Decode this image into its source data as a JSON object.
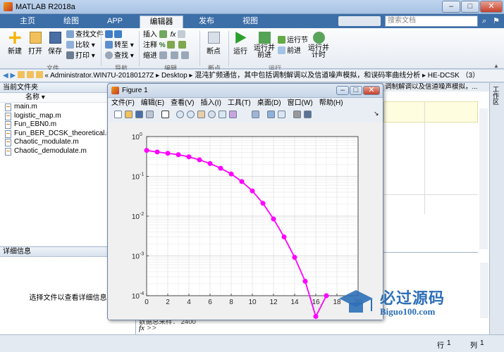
{
  "window": {
    "title": "MATLAB R2018a"
  },
  "tabs": [
    "主页",
    "绘图",
    "APP",
    "编辑器",
    "发布",
    "视图"
  ],
  "search_placeholder": "搜索文档",
  "ribbon": {
    "file": {
      "new": "新建",
      "open": "打开",
      "save": "保存",
      "find_files": "查找文件",
      "compare": "比较",
      "print": "打印",
      "group": "文件"
    },
    "nav": {
      "goto": "转至",
      "find": "查找",
      "group": "导航"
    },
    "edit": {
      "insert": "插入",
      "comment": "注释",
      "indent": "缩进",
      "fx": "fx",
      "group": "编辑"
    },
    "breakpoints": {
      "breakpoints": "断点",
      "group": "断点"
    },
    "run": {
      "run": "运行",
      "run_advance": "运行并\n前进",
      "run_section": "运行节",
      "advance": "前进",
      "run_time": "运行并\n计时",
      "group": "运行"
    }
  },
  "address": {
    "path": "«  Administrator.WIN7U-20180127Z  ▸  Desktop  ▸  混沌扩频通信，其中包括调制解调以及信道噪声模拟，和误码率曲线分析  ▸  HE-DCSK （3）"
  },
  "current_folder": {
    "title": "当前文件夹",
    "col_name": "名称 ▾",
    "files": [
      "main.m",
      "logistic_map.m",
      "Fun_EBN0.m",
      "Fun_BER_DCSK_theoretical.m",
      "Chaotic_modulate.m",
      "Chaotic_demodulate.m"
    ]
  },
  "details": {
    "title": "详细信息",
    "empty_text": "选择文件以查看详细信息"
  },
  "editor_tab": {
    "text": "调制解调以及信道噪声模拟，..."
  },
  "workspace_label": "工作区",
  "command": {
    "prompt": "fx >>",
    "output": "数据总采样：  2400"
  },
  "status": {
    "line_label": "行",
    "line": "1",
    "col_label": "列",
    "col": "1"
  },
  "figure": {
    "title": "Figure 1",
    "menu": [
      "文件(F)",
      "编辑(E)",
      "查看(V)",
      "插入(I)",
      "工具(T)",
      "桌面(D)",
      "窗口(W)",
      "帮助(H)"
    ]
  },
  "watermark": {
    "text": "必过源码",
    "sub": "Biguo100.com"
  },
  "colors": {
    "line": "#ff00ff",
    "tabbar": "#3c6ea8"
  },
  "chart_data": {
    "type": "line",
    "x": [
      0,
      1,
      2,
      3,
      4,
      5,
      6,
      7,
      8,
      9,
      10,
      11,
      12,
      13,
      14,
      15,
      16,
      17
    ],
    "y": [
      0.45,
      0.41,
      0.38,
      0.35,
      0.31,
      0.26,
      0.21,
      0.16,
      0.115,
      0.074,
      0.043,
      0.021,
      0.0085,
      0.003,
      0.00092,
      0.00023,
      3e-05,
      0.0001
    ],
    "xlim": [
      0,
      20
    ],
    "ylim_log10": [
      -4,
      0
    ],
    "xticks": [
      "0",
      "2",
      "4",
      "6",
      "8",
      "10",
      "12",
      "14",
      "16",
      "18",
      "20"
    ],
    "yscale": "log",
    "grid": true,
    "marker": "circle"
  }
}
